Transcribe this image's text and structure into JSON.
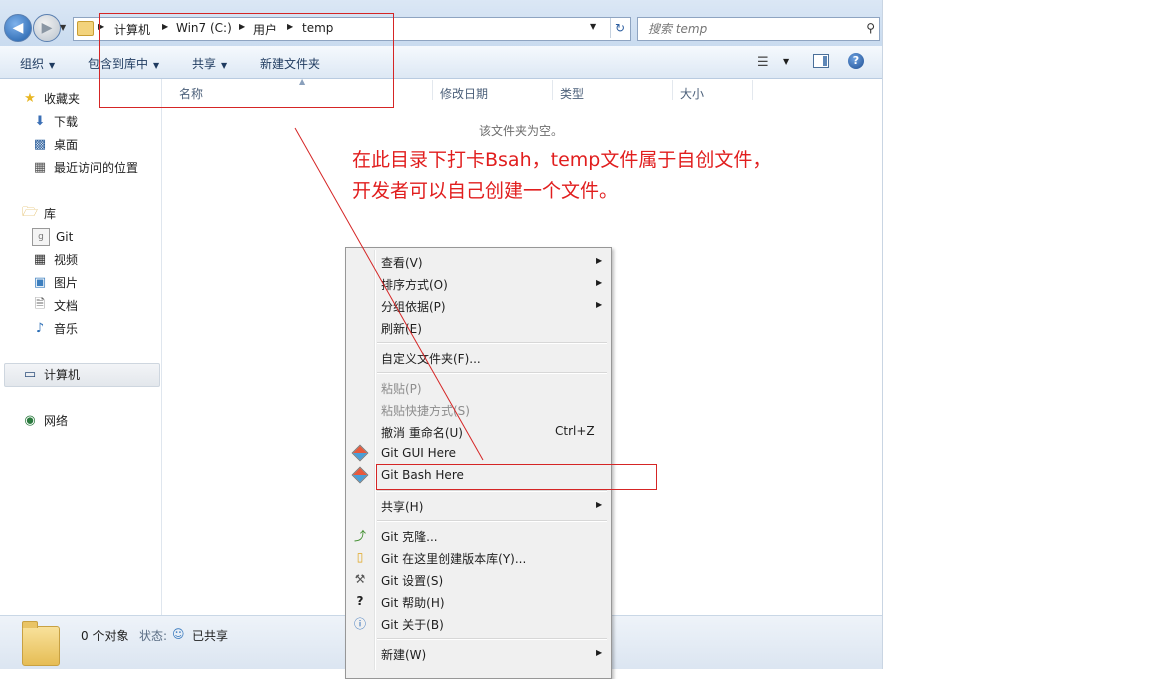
{
  "address": {
    "crumbs": [
      "计算机",
      "Win7 (C:)",
      "用户",
      "temp"
    ],
    "search_placeholder": "搜索 temp"
  },
  "toolbar": {
    "organize": "组织",
    "include_library": "包含到库中",
    "share": "共享",
    "new_folder": "新建文件夹"
  },
  "columns": {
    "name": "名称",
    "modified": "修改日期",
    "type": "类型",
    "size": "大小"
  },
  "sidebar": {
    "favorites": "收藏夹",
    "downloads": "下载",
    "desktop": "桌面",
    "recent": "最近访问的位置",
    "libraries": "库",
    "git": "Git",
    "videos": "视频",
    "pictures": "图片",
    "documents": "文档",
    "music": "音乐",
    "computer": "计算机",
    "network": "网络"
  },
  "main": {
    "empty_message": "该文件夹为空。"
  },
  "status": {
    "count": "0 个对象",
    "state_label": "状态:",
    "state_value": "已共享"
  },
  "context_menu": {
    "view": "查看(V)",
    "sort_by": "排序方式(O)",
    "group_by": "分组依据(P)",
    "refresh": "刷新(E)",
    "customize": "自定义文件夹(F)...",
    "paste": "粘贴(P)",
    "paste_shortcut": "粘贴快捷方式(S)",
    "undo_rename": "撤消 重命名(U)",
    "undo_shortcut": "Ctrl+Z",
    "git_gui": "Git GUI Here",
    "git_bash": "Git Bash Here",
    "share": "共享(H)",
    "git_clone": "Git 克隆...",
    "git_create_repo": "Git 在这里创建版本库(Y)...",
    "git_settings": "Git 设置(S)",
    "git_help": "Git 帮助(H)",
    "git_about": "Git 关于(B)",
    "new": "新建(W)"
  },
  "annotation": {
    "text": "在此目录下打卡Bsah，temp文件属于自创文件，开发者可以自己创建一个文件。",
    "color": "#e11e1e"
  }
}
